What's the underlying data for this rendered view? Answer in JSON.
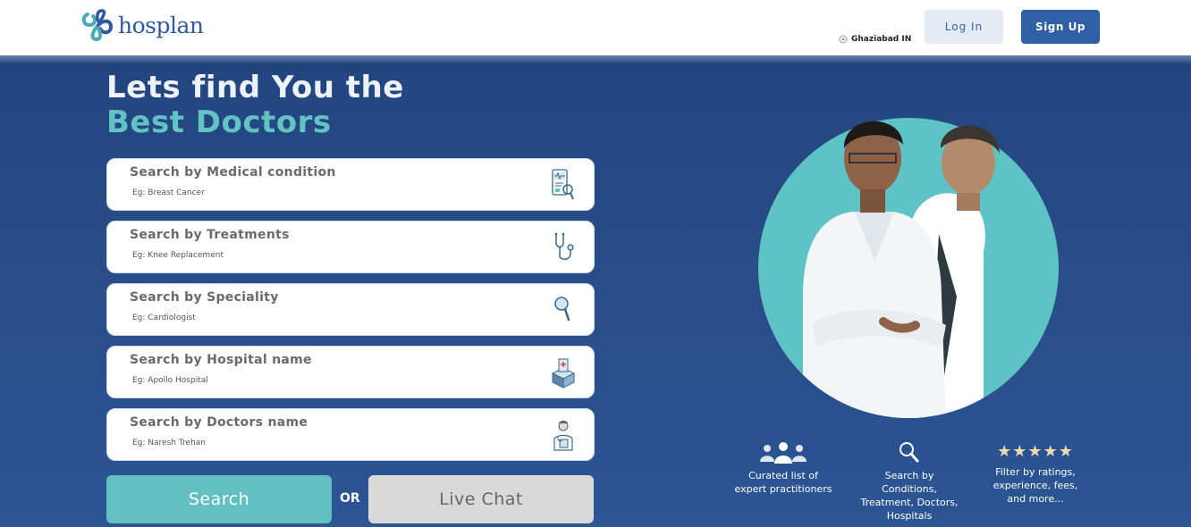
{
  "header": {
    "brand": "hosplan",
    "location": "Ghaziabad IN",
    "login_label": "Log In",
    "signup_label": "Sign Up"
  },
  "hero": {
    "headline_line1": "Lets find You the",
    "headline_line2": "Best Doctors"
  },
  "search_fields": [
    {
      "title": "Search by Medical condition",
      "hint": "Eg: Breast Cancer",
      "icon": "medical-report-icon"
    },
    {
      "title": "Search by Treatments",
      "hint": "Eg: Knee Replacement",
      "icon": "stethoscope-icon"
    },
    {
      "title": "Search by Speciality",
      "hint": "Eg: Cardiologist",
      "icon": "magnifier-icon"
    },
    {
      "title": "Search by Hospital name",
      "hint": "Eg: Apollo Hospital",
      "icon": "hospital-building-icon"
    },
    {
      "title": "Search by Doctors name",
      "hint": "Eg: Naresh Trehan",
      "icon": "doctor-icon"
    }
  ],
  "actions": {
    "search_label": "Search",
    "or_label": "OR",
    "live_chat_label": "Live Chat"
  },
  "features": [
    {
      "icon": "practitioners-group-icon",
      "text_line1": "Curated list of",
      "text_line2": "expert practitioners"
    },
    {
      "icon": "search-icon",
      "text_line1": "Search by",
      "text_line2": "Conditions,",
      "text_line3": "Treatment, Doctors,",
      "text_line4": "Hospitals"
    },
    {
      "icon": "star-rating-icon",
      "stars": "★★★★★",
      "text_line1": "Filter by ratings,",
      "text_line2": "experience, fees,",
      "text_line3": "and more..."
    }
  ],
  "colors": {
    "primary_blue": "#2f5fa5",
    "hero_bg": "#284c86",
    "teal": "#63bfc0",
    "login_bg": "#e4ebf5"
  }
}
